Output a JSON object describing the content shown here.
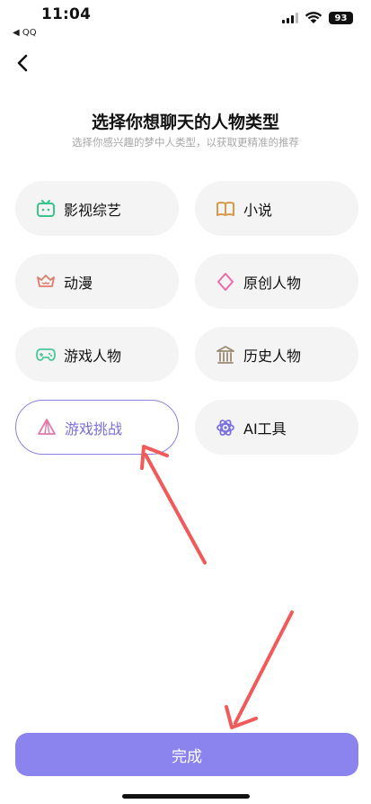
{
  "status_bar": {
    "time": "11:04",
    "back_app": "◀ QQ",
    "battery": "93"
  },
  "header": {
    "title": "选择你想聊天的人物类型",
    "subtitle": "选择你感兴趣的梦中人类型，以获取更精准的推荐"
  },
  "categories": [
    {
      "label": "影视综艺",
      "icon": "tv-icon",
      "color": "#3ac48a",
      "selected": false
    },
    {
      "label": "小说",
      "icon": "book-icon",
      "color": "#d69a4a",
      "selected": false
    },
    {
      "label": "动漫",
      "icon": "anime-icon",
      "color": "#e07a6a",
      "selected": false
    },
    {
      "label": "原创人物",
      "icon": "diamond-icon",
      "color": "#ee6aa8",
      "selected": false
    },
    {
      "label": "游戏人物",
      "icon": "gamepad-icon",
      "color": "#4cc79a",
      "selected": false
    },
    {
      "label": "历史人物",
      "icon": "temple-icon",
      "color": "#9a8a72",
      "selected": false
    },
    {
      "label": "游戏挑战",
      "icon": "pyramid-icon",
      "color": "#e07aa8",
      "selected": true
    },
    {
      "label": "AI工具",
      "icon": "atom-icon",
      "color": "#7b6fe0",
      "selected": false
    }
  ],
  "footer": {
    "done_label": "完成"
  },
  "colors": {
    "accent": "#8b84ee",
    "selected_border": "#8a82e6",
    "annotation_arrow": "#f05a5a"
  }
}
